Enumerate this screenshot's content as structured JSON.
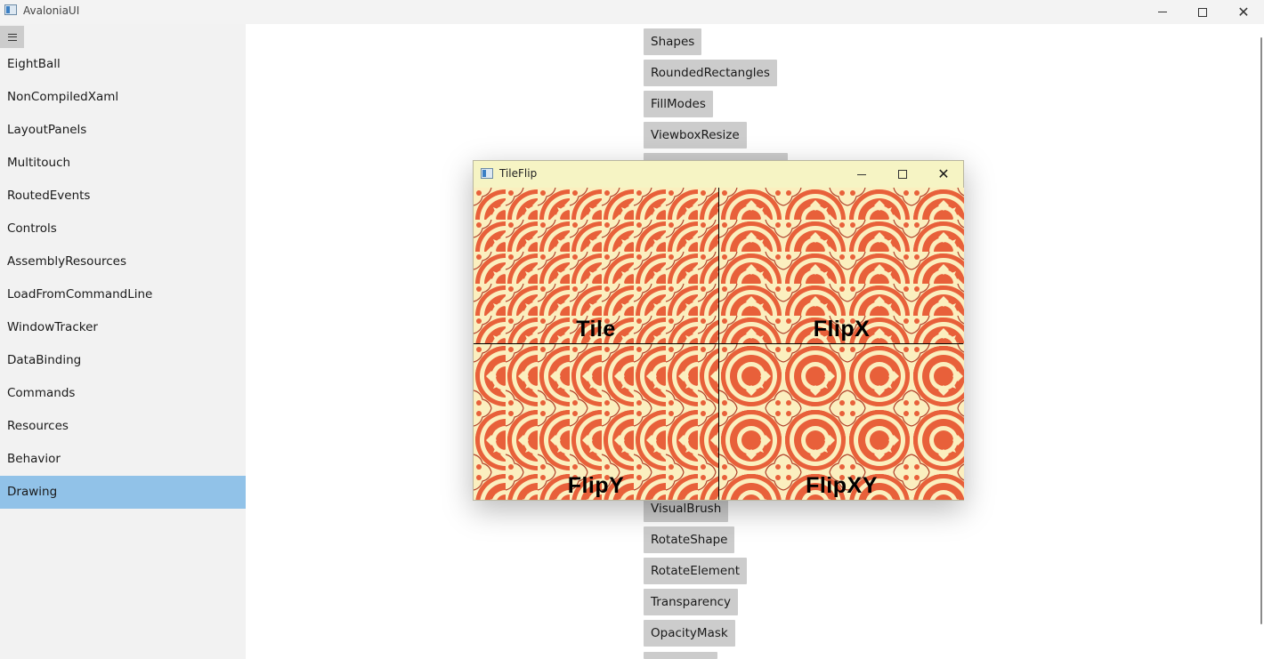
{
  "window": {
    "title": "AvaloniaUI",
    "minimize_icon": "minimize-icon",
    "maximize_icon": "maximize-icon",
    "close_icon": "close-icon"
  },
  "sidebar": {
    "toggle_icon": "hamburger-icon",
    "items": [
      {
        "label": "EightBall"
      },
      {
        "label": "NonCompiledXaml"
      },
      {
        "label": "LayoutPanels"
      },
      {
        "label": "Multitouch"
      },
      {
        "label": "RoutedEvents"
      },
      {
        "label": "Controls"
      },
      {
        "label": "AssemblyResources"
      },
      {
        "label": "LoadFromCommandLine"
      },
      {
        "label": "WindowTracker"
      },
      {
        "label": "DataBinding"
      },
      {
        "label": "Commands"
      },
      {
        "label": "Resources"
      },
      {
        "label": "Behavior"
      },
      {
        "label": "Drawing"
      }
    ],
    "selected": "Drawing",
    "selected_color": "#91c2e8"
  },
  "main": {
    "buttons_top": [
      {
        "label": "Shapes"
      },
      {
        "label": "RoundedRectangles"
      },
      {
        "label": "FillModes"
      },
      {
        "label": "ViewboxResize"
      }
    ],
    "buttons_bottom": [
      {
        "label": "VisualBrush"
      },
      {
        "label": "RotateShape"
      },
      {
        "label": "RotateElement"
      },
      {
        "label": "Transparency"
      },
      {
        "label": "OpacityMask"
      }
    ]
  },
  "child_window": {
    "title": "TileFlip",
    "background": "#f9f8d4",
    "tiles": [
      {
        "label": "Tile"
      },
      {
        "label": "FlipX"
      },
      {
        "label": "FlipY"
      },
      {
        "label": "FlipXY"
      }
    ],
    "pattern_colors": {
      "light": "#fbefbf",
      "accent": "#e8603a",
      "dark": "#b0402a"
    }
  }
}
